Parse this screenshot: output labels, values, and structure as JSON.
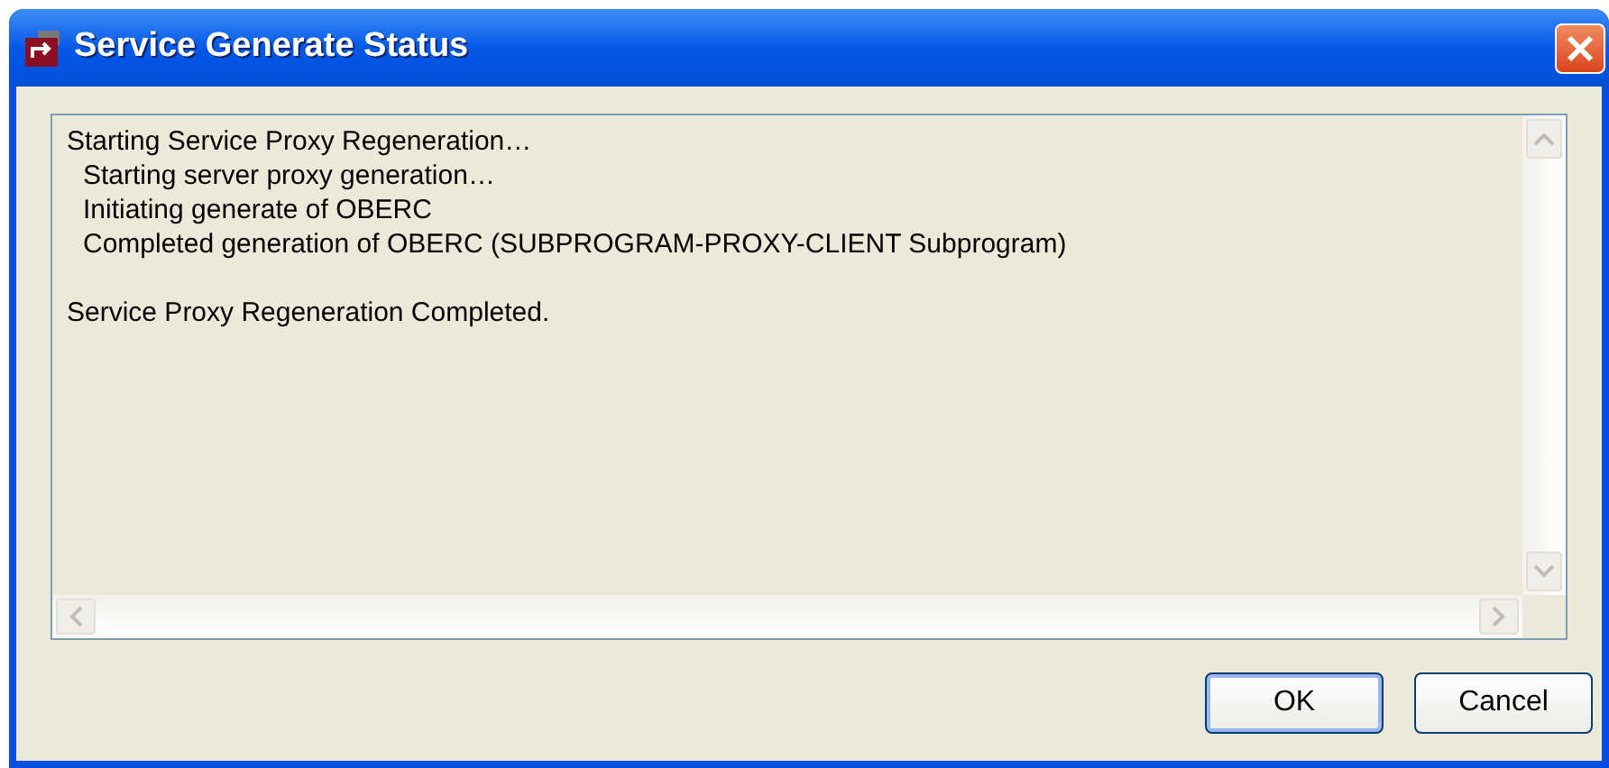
{
  "window": {
    "title": "Service Generate Status"
  },
  "log": [
    {
      "text": "Starting Service Proxy Regeneration…",
      "children": [
        {
          "text": "Starting server proxy generation…"
        },
        {
          "text": "Initiating generate of OBERC"
        },
        {
          "text": "Completed generation of OBERC (SUBPROGRAM-PROXY-CLIENT Subprogram)"
        }
      ]
    },
    {
      "text": "Service Proxy Regeneration Completed."
    }
  ],
  "buttons": [
    {
      "label": "OK",
      "default": true
    },
    {
      "label": "Cancel",
      "default": false
    }
  ]
}
